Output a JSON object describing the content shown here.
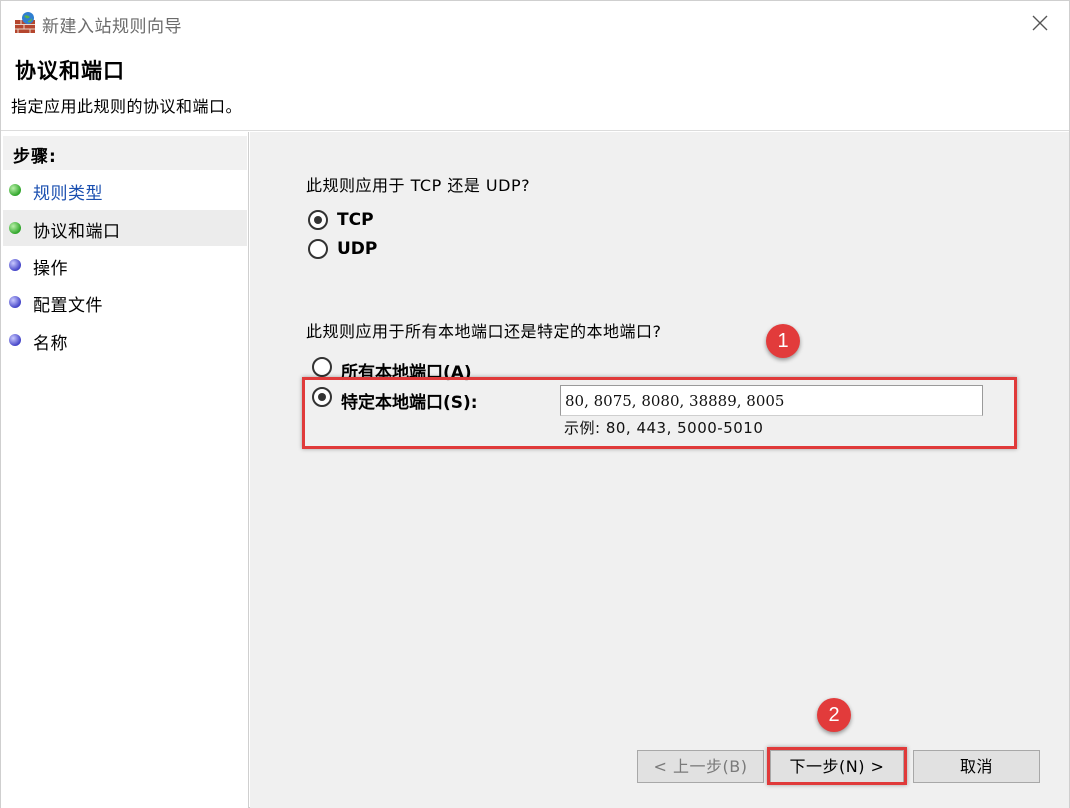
{
  "window": {
    "title": "新建入站规则向导",
    "icon": "firewall-icon",
    "close_icon": "close-icon"
  },
  "header": {
    "title": "协议和端口",
    "subtitle": "指定应用此规则的协议和端口。"
  },
  "steps": {
    "title": "步骤:",
    "items": [
      {
        "label": "规则类型",
        "status": "done",
        "link": true
      },
      {
        "label": "协议和端口",
        "status": "current",
        "link": false
      },
      {
        "label": "操作",
        "status": "pending",
        "link": false
      },
      {
        "label": "配置文件",
        "status": "pending",
        "link": false
      },
      {
        "label": "名称",
        "status": "pending",
        "link": false
      }
    ]
  },
  "protocol": {
    "question": "此规则应用于 TCP 还是 UDP?",
    "options": [
      {
        "label": "TCP",
        "checked": true
      },
      {
        "label": "UDP",
        "checked": false
      }
    ]
  },
  "ports": {
    "question": "此规则应用于所有本地端口还是特定的本地端口?",
    "options": [
      {
        "label": "所有本地端口(A)",
        "checked": false
      },
      {
        "label": "特定本地端口(S):",
        "checked": true
      }
    ],
    "value": "80, 8075, 8080, 38889, 8005",
    "example": "示例: 80, 443, 5000-5010"
  },
  "annotations": {
    "marker1": "1",
    "marker2": "2",
    "highlight_color": "#e03a3a"
  },
  "buttons": {
    "back": "< 上一步(B)",
    "next": "下一步(N) >",
    "cancel": "取消"
  }
}
